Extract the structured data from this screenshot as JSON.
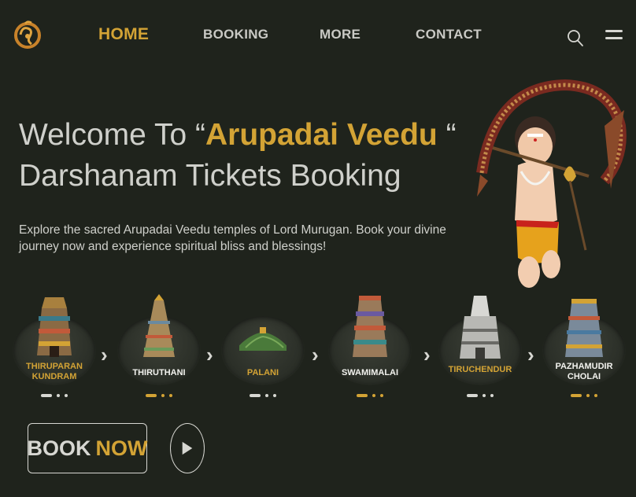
{
  "nav": {
    "items": [
      {
        "label": "HOME",
        "active": true
      },
      {
        "label": "BOOKING",
        "active": false
      },
      {
        "label": "MORE",
        "active": false
      },
      {
        "label": "CONTACT",
        "active": false
      }
    ]
  },
  "icons": {
    "logo": "om-tamil-logo",
    "search": "search-icon",
    "menu": "hamburger-menu-icon",
    "play": "play-icon",
    "chevron": "chevron-right-icon"
  },
  "hero": {
    "title_prefix": "Welcome To “",
    "title_highlight": "Arupadai Veedu",
    "title_suffix": " “",
    "title_line2": "Darshanam Tickets Booking",
    "description": "Explore the sacred Arupadai Veedu temples of Lord Murugan. Book your divine journey now and experience spiritual bliss and blessings!"
  },
  "temples": [
    {
      "line1": "THIRUPARAN",
      "line2": "KUNDRAM",
      "highlight": true
    },
    {
      "line1": "THIRUTHANI",
      "line2": "",
      "highlight": false
    },
    {
      "line1": "PALANI",
      "line2": "",
      "highlight": true
    },
    {
      "line1": "SWAMIMALAI",
      "line2": "",
      "highlight": false
    },
    {
      "line1": "TIRUCHENDUR",
      "line2": "",
      "highlight": true
    },
    {
      "line1": "PAZHAMUDIR",
      "line2": "CHOLAI",
      "highlight": false
    }
  ],
  "chevron_symbol": "›",
  "cta": {
    "book_part1": "BOOK",
    "book_part2": "NOW"
  },
  "colors": {
    "background": "#1f231c",
    "accent": "#d3a335",
    "text": "#d7d7d2"
  }
}
